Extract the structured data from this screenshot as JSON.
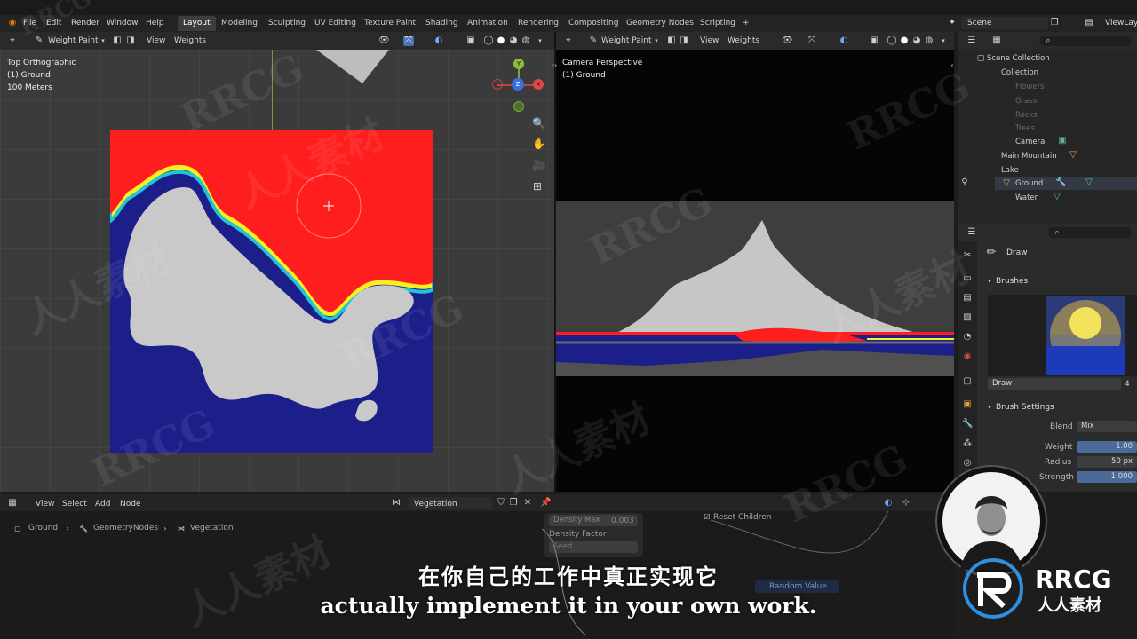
{
  "top_menu": [
    "File",
    "Edit",
    "Render",
    "Window",
    "Help"
  ],
  "workspaces": {
    "tabs": [
      "Layout",
      "Modeling",
      "Sculpting",
      "UV Editing",
      "Texture Paint",
      "Shading",
      "Animation",
      "Rendering",
      "Compositing",
      "Geometry Nodes",
      "Scripting"
    ],
    "active": "Layout",
    "plus": "+"
  },
  "scene": {
    "label": "Scene",
    "view_layer": "ViewLayer"
  },
  "left_viewport": {
    "mode": "Weight Paint",
    "menu": [
      "View",
      "Weights"
    ],
    "overlay": [
      "Top Orthographic",
      "(1) Ground",
      "100 Meters"
    ],
    "gizmo": {
      "x": "X",
      "y": "Y",
      "z": "Z"
    }
  },
  "right_viewport": {
    "mode": "Weight Paint",
    "menu": [
      "View",
      "Weights"
    ],
    "overlay": [
      "Camera Perspective",
      "(1) Ground"
    ]
  },
  "outliner": {
    "items": [
      {
        "label": "Scene Collection",
        "dim": false
      },
      {
        "label": "Collection",
        "dim": false
      },
      {
        "label": "Flowers",
        "dim": true
      },
      {
        "label": "Grass",
        "dim": true
      },
      {
        "label": "Rocks",
        "dim": true
      },
      {
        "label": "Trees",
        "dim": true
      },
      {
        "label": "Camera",
        "dim": false
      },
      {
        "label": "Main Mountain",
        "dim": false
      },
      {
        "label": "Lake",
        "dim": false
      },
      {
        "label": "Ground",
        "dim": false
      },
      {
        "label": "Water",
        "dim": false
      }
    ]
  },
  "properties": {
    "tool": "Draw",
    "brushes_panel": "Brushes",
    "brush_name": "Draw",
    "brush_count": "4",
    "settings_panel": "Brush Settings",
    "blend_label": "Blend",
    "blend_value": "Mix",
    "weight_label": "Weight",
    "weight_value": "1.00",
    "radius_label": "Radius",
    "radius_value": "50 px",
    "strength_label": "Strength",
    "strength_value": "1.000"
  },
  "node_editor": {
    "menu": [
      "View",
      "Select",
      "Add",
      "Node"
    ],
    "tree": "Vegetation",
    "breadcrumb": [
      "Ground",
      "GeometryNodes",
      "Vegetation"
    ],
    "node_fields": [
      "Density Max",
      "0.003",
      "Density Factor",
      "Seed"
    ],
    "reset_children": "Reset Children",
    "random_value": "Random Value"
  },
  "subtitles": {
    "cn": "在你自己的工作中真正实现它",
    "en": "actually implement it in your own work."
  },
  "branding": {
    "logo_text": "RRCG",
    "logo_cn": "人人素材",
    "watermark_en": "RRCG",
    "watermark_cn": "人人素材"
  },
  "colors": {
    "red": "#ff1e1e",
    "blue": "#1c1f8a",
    "mesh": "#c9c9c9",
    "accent": "#4772b3"
  }
}
